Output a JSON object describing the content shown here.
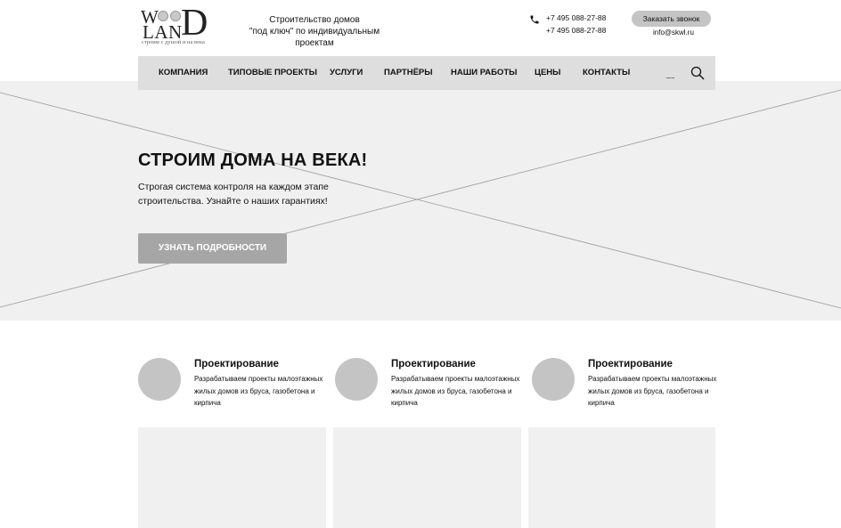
{
  "logo": {
    "row1": "W  D",
    "row2": "LAN",
    "letter_d": "D",
    "tagline": "строим с душой и на века"
  },
  "header": {
    "tagline_line1": "Строительство домов",
    "tagline_line2": "\"под ключ\" по индивидуальным проектам",
    "phone1": "+7 495 088-27-88",
    "phone2": "+7 495 088-27-88",
    "callback_label": "Заказать звонок",
    "email": "info@skwl.ru"
  },
  "nav": {
    "items": [
      {
        "label": "КОМПАНИЯ"
      },
      {
        "label": "ТИПОВЫЕ ПРОЕКТЫ"
      },
      {
        "label": "УСЛУГИ"
      },
      {
        "label": "ПАРТНЁРЫ"
      },
      {
        "label": "НАШИ РАБОТЫ"
      },
      {
        "label": "ЦЕНЫ"
      },
      {
        "label": "КОНТАКТЫ"
      }
    ],
    "dots": "........"
  },
  "hero": {
    "title": "СТРОИМ ДОМА НА ВЕКА!",
    "subtitle_line1": "Строгая система контроля на каждом этапе",
    "subtitle_line2": "строительства. Узнайте о наших гарантиях!",
    "button_label": "УЗНАТЬ ПОДРОБНОСТИ"
  },
  "features": [
    {
      "title": "Проектирование",
      "text": "Разрабатываем проекты малоэтажных жилых домов из бруса, газобетона и кирпича"
    },
    {
      "title": "Проектирование",
      "text": "Разрабатываем проекты малоэтажных жилых домов из бруса, газобетона и кирпича"
    },
    {
      "title": "Проектирование",
      "text": "Разрабатываем проекты малоэтажных жилых домов из бруса, газобетона и кирпича"
    }
  ],
  "colors": {
    "nav_bg": "#dedede",
    "hero_bg": "#f0f0f0",
    "button_bg": "#a6a6a6",
    "placeholder": "#c4c4c4"
  }
}
